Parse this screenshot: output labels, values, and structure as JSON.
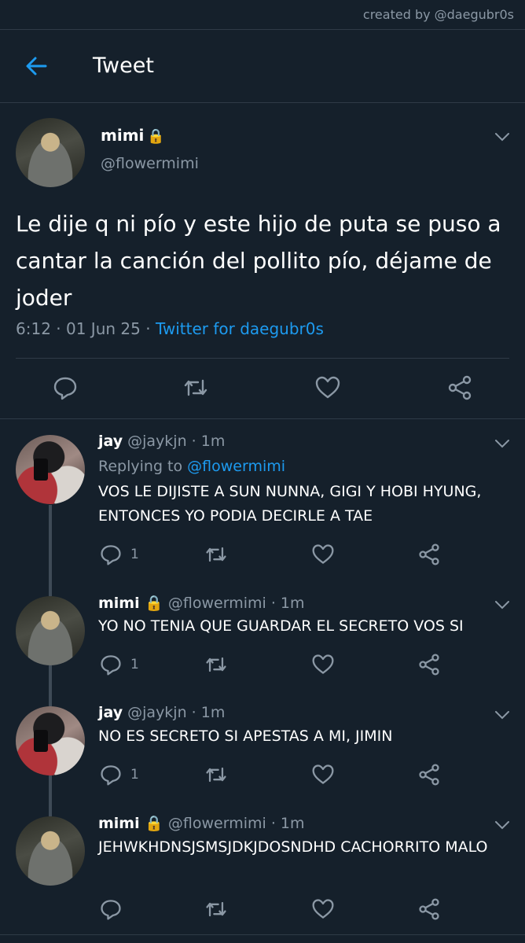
{
  "credit": "created by @daegubr0s",
  "header": {
    "title": "Tweet"
  },
  "main_tweet": {
    "name": "mimi",
    "lock": "🔒",
    "handle": "@flowermimi",
    "text": "Le dije q ni pío y este hijo de puta se puso a cantar la canción del pollito pío, déjame de joder",
    "time": "6:12",
    "date": "01 Jun 25",
    "source": "Twitter for daegubr0s",
    "sep": "·"
  },
  "replies": [
    {
      "name": "jay",
      "lock": "",
      "handle": "@jaykjn",
      "time": "1m",
      "replying_label": "Replying to",
      "replying_to": "@flowermimi",
      "text": "VOS LE DIJISTE A SUN NUNNA, GIGI Y HOBI HYUNG, ENTONCES YO PODIA DECIRLE A TAE",
      "reply_count": "1"
    },
    {
      "name": "mimi",
      "lock": "🔒",
      "handle": "@flowermimi",
      "time": "1m",
      "text": "YO NO TENIA QUE GUARDAR EL SECRETO VOS SI",
      "reply_count": "1"
    },
    {
      "name": "jay",
      "lock": "",
      "handle": "@jaykjn",
      "time": "1m",
      "text": "NO ES SECRETO SI APESTAS A MI, JIMIN",
      "reply_count": "1"
    },
    {
      "name": "mimi",
      "lock": "🔒",
      "handle": "@flowermimi",
      "time": "1m",
      "text": "JEHWKHDNSJSMSJDKJDOSNDHD CACHORRITO MALO",
      "reply_count": ""
    }
  ],
  "colors": {
    "background": "#15202b",
    "accent": "#1d9bf0",
    "muted": "#8b98a5",
    "divider": "#2f3b47"
  },
  "icons": [
    "back-arrow-icon",
    "chevron-down-icon",
    "reply-icon",
    "retweet-icon",
    "like-icon",
    "share-icon",
    "lock-icon"
  ]
}
